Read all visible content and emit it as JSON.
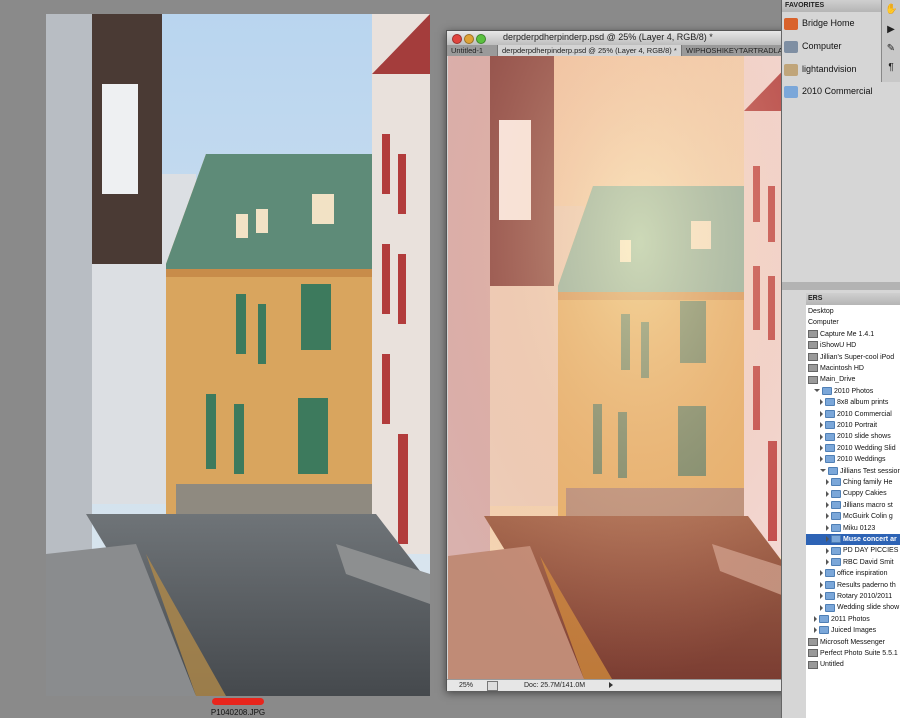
{
  "left_preview": {
    "file_name": "P1040208.JPG",
    "rating_color": "#e8251c"
  },
  "ps_window": {
    "title": "derpderpdherpinderp.psd @ 25% (Layer 4, RGB/8) *",
    "tabs": [
      "Untitled-1",
      "derpderpdherpinderp.psd @ 25% (Layer 4, RGB/8) *",
      "WIPHOSHIKEYTARTRADLACI",
      ">>"
    ],
    "zoom": "25%",
    "doc_size": "Doc: 25.7M/141.0M"
  },
  "favorites": {
    "header": "FAVORITES",
    "items": [
      {
        "label": "Bridge Home",
        "icon": "bridge-home-icon",
        "color": "#d9622b"
      },
      {
        "label": "Computer",
        "icon": "computer-icon",
        "color": "#7f8fa3"
      },
      {
        "label": "lightandvision",
        "icon": "home-folder-icon",
        "color": "#c0a57a"
      },
      {
        "label": "2010 Commercial",
        "icon": "folder-icon",
        "color": "#7ba7d9"
      }
    ]
  },
  "tools": [
    "hand-tool-icon",
    "play-icon",
    "edit-icon",
    "paragraph-icon"
  ],
  "folders": {
    "header": "ERS",
    "rows": [
      {
        "label": "Desktop",
        "indent": 0,
        "kind": "plain"
      },
      {
        "label": "Computer",
        "indent": 0,
        "kind": "plain"
      },
      {
        "label": "Capture Me 1.4.1",
        "indent": 0,
        "kind": "drive"
      },
      {
        "label": "iShowU HD",
        "indent": 0,
        "kind": "drive"
      },
      {
        "label": "Jillian's Super-cool iPod",
        "indent": 0,
        "kind": "drive"
      },
      {
        "label": "Macintosh HD",
        "indent": 0,
        "kind": "drive"
      },
      {
        "label": "Main_Drive",
        "indent": 0,
        "kind": "drive"
      },
      {
        "label": "2010 Photos",
        "indent": 1,
        "kind": "folder-open"
      },
      {
        "label": "8x8 album prints",
        "indent": 2,
        "kind": "folder"
      },
      {
        "label": "2010 Commercial",
        "indent": 2,
        "kind": "folder"
      },
      {
        "label": "2010 Portrait",
        "indent": 2,
        "kind": "folder"
      },
      {
        "label": "2010 slide shows",
        "indent": 2,
        "kind": "folder"
      },
      {
        "label": "2010 Wedding Slid",
        "indent": 2,
        "kind": "folder"
      },
      {
        "label": "2010 Weddings",
        "indent": 2,
        "kind": "folder"
      },
      {
        "label": "Jillians Test session",
        "indent": 2,
        "kind": "folder-open"
      },
      {
        "label": "Ching family He",
        "indent": 3,
        "kind": "folder"
      },
      {
        "label": "Cuppy Cakies",
        "indent": 3,
        "kind": "folder"
      },
      {
        "label": "Jillians macro st",
        "indent": 3,
        "kind": "folder"
      },
      {
        "label": "McGuirk Colin g",
        "indent": 3,
        "kind": "folder"
      },
      {
        "label": "Miku 0123",
        "indent": 3,
        "kind": "folder"
      },
      {
        "label": "Muse concert ar",
        "indent": 3,
        "kind": "folder",
        "selected": true
      },
      {
        "label": "PD DAY PICCIES",
        "indent": 3,
        "kind": "folder"
      },
      {
        "label": "RBC David Smit",
        "indent": 3,
        "kind": "folder"
      },
      {
        "label": "office inspiration",
        "indent": 2,
        "kind": "folder"
      },
      {
        "label": "Results paderno th",
        "indent": 2,
        "kind": "folder"
      },
      {
        "label": "Rotary 2010/2011",
        "indent": 2,
        "kind": "folder"
      },
      {
        "label": "Wedding slide show",
        "indent": 2,
        "kind": "folder"
      },
      {
        "label": "2011 Photos",
        "indent": 1,
        "kind": "folder"
      },
      {
        "label": "Juiced Images",
        "indent": 1,
        "kind": "folder"
      },
      {
        "label": "Microsoft Messenger",
        "indent": 0,
        "kind": "drive"
      },
      {
        "label": "Perfect Photo Suite 5.5.1",
        "indent": 0,
        "kind": "drive"
      },
      {
        "label": "Untitled",
        "indent": 0,
        "kind": "drive"
      }
    ]
  }
}
